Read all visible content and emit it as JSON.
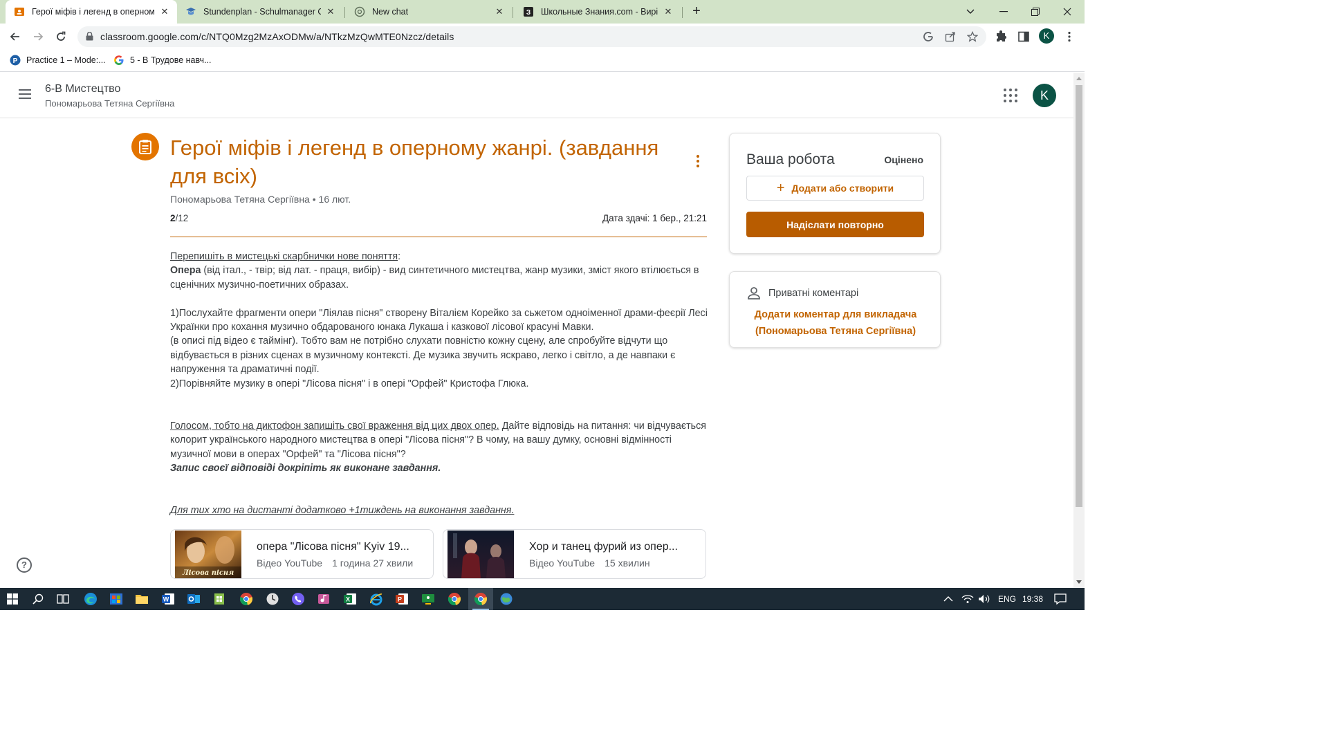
{
  "browser": {
    "tabs": [
      {
        "title": "Герої міфів і легенд в оперному",
        "active": true,
        "icon": "classroom-icon"
      },
      {
        "title": "Stundenplan - Schulmanager Onl",
        "active": false,
        "icon": "schulmanager-icon"
      },
      {
        "title": "New chat",
        "active": false,
        "icon": "chatgpt-icon"
      },
      {
        "title": "Школьные Знания.com - Виріш",
        "active": false,
        "icon": "znanija-icon"
      }
    ],
    "url": "classroom.google.com/c/NTQ0Mzg2MzAxODMw/a/NTkzMzQwMTE0Nzcz/details",
    "bookmarks": [
      {
        "label": "Practice 1 – Mode:..."
      },
      {
        "label": "5 - В Трудове навч..."
      }
    ],
    "profile_initial": "K"
  },
  "classroom": {
    "class_name": "6-В Мистецтво",
    "teacher": "Пономарьова Тетяна Сергіївна",
    "avatar_initial": "K"
  },
  "assignment": {
    "title": "Герої міфів і легенд в оперному жанрі. (завдання для всіх)",
    "author": "Пономарьова Тетяна Сергіївна",
    "date": "16 лют.",
    "points_earned": "2",
    "points_total": "/12",
    "due": "Дата здачі: 1 бер., 21:21",
    "description": {
      "p1_underline": "Перепишіть в мистецькі скарбнички нове поняття",
      "p1_colon": ":",
      "p2_bold": "Опера",
      "p2_rest": " (від італ., - твір; від лат. - праця, вибір) - вид синтетичного мистецтва, жанр музики, зміст якого втілюється в сценічних музично-поетичних образах.",
      "p3": "1)Послухайте фрагменти опери \"Ліялав пісня\" створену Віталієм Корейко за сьжетом одноіменної драми-феєрії Лесі Українки про кохання музично обдарованого юнака Лукаша і казкової лісової красуні Мавки.",
      "p4": "(в описі під відео є таймінг). Тобто вам не потрібно слухати повністю кожну сцену, але спробуйте відчути що відбувається в різних сценах в музичному контексті. Де музика звучить яскраво, легко і світло, а де навпаки є напруження та драматичні події.",
      "p5": "2)Порівняйте музику в опері \"Лісова пісня\" і в опері \"Орфей\" Кристофа Глюка.",
      "p6_underline": "Голосом, тобто на диктофон запишіть свої враження від цих двох опер.",
      "p6_rest": " Дайте відповідь на питання: чи відчувається колорит українського народного мистецтва в опері \"Лісова пісня\"? В чому, на вашу думку, основні відмінності музичної мови в операх \"Орфей\" та \"Лісова пісня\"?",
      "p7_bolditalic": "Запис своєї відповіді докріпіть як виконане завдання.",
      "p8_italic_underline": "Для тих хто на дистанті додатково +1тиждень на виконання завдання."
    },
    "attachments": [
      {
        "title": "опера \"Лісова пісня\" Kyiv 19...",
        "source": "Відео YouTube",
        "duration": "1 година 27 хвили",
        "thumb_caption": "Лісова пісня"
      },
      {
        "title": "Хор и танец фурий из опер...",
        "source": "Відео YouTube",
        "duration": "15 хвилин"
      }
    ]
  },
  "your_work": {
    "title": "Ваша робота",
    "status": "Оцінено",
    "add_label": "Додати або створити",
    "resubmit_label": "Надіслати повторно"
  },
  "private_comments": {
    "title": "Приватні коментарі",
    "add_line1": "Додати коментар для викладача",
    "add_line2": "(Пономарьова Тетяна Сергіївна)"
  },
  "taskbar": {
    "lang": "ENG",
    "time": "19:38"
  },
  "colors": {
    "accent": "#c26401",
    "button": "#b85c00",
    "tabstrip": "#d2e3c8",
    "taskbar": "#1c2a35"
  }
}
